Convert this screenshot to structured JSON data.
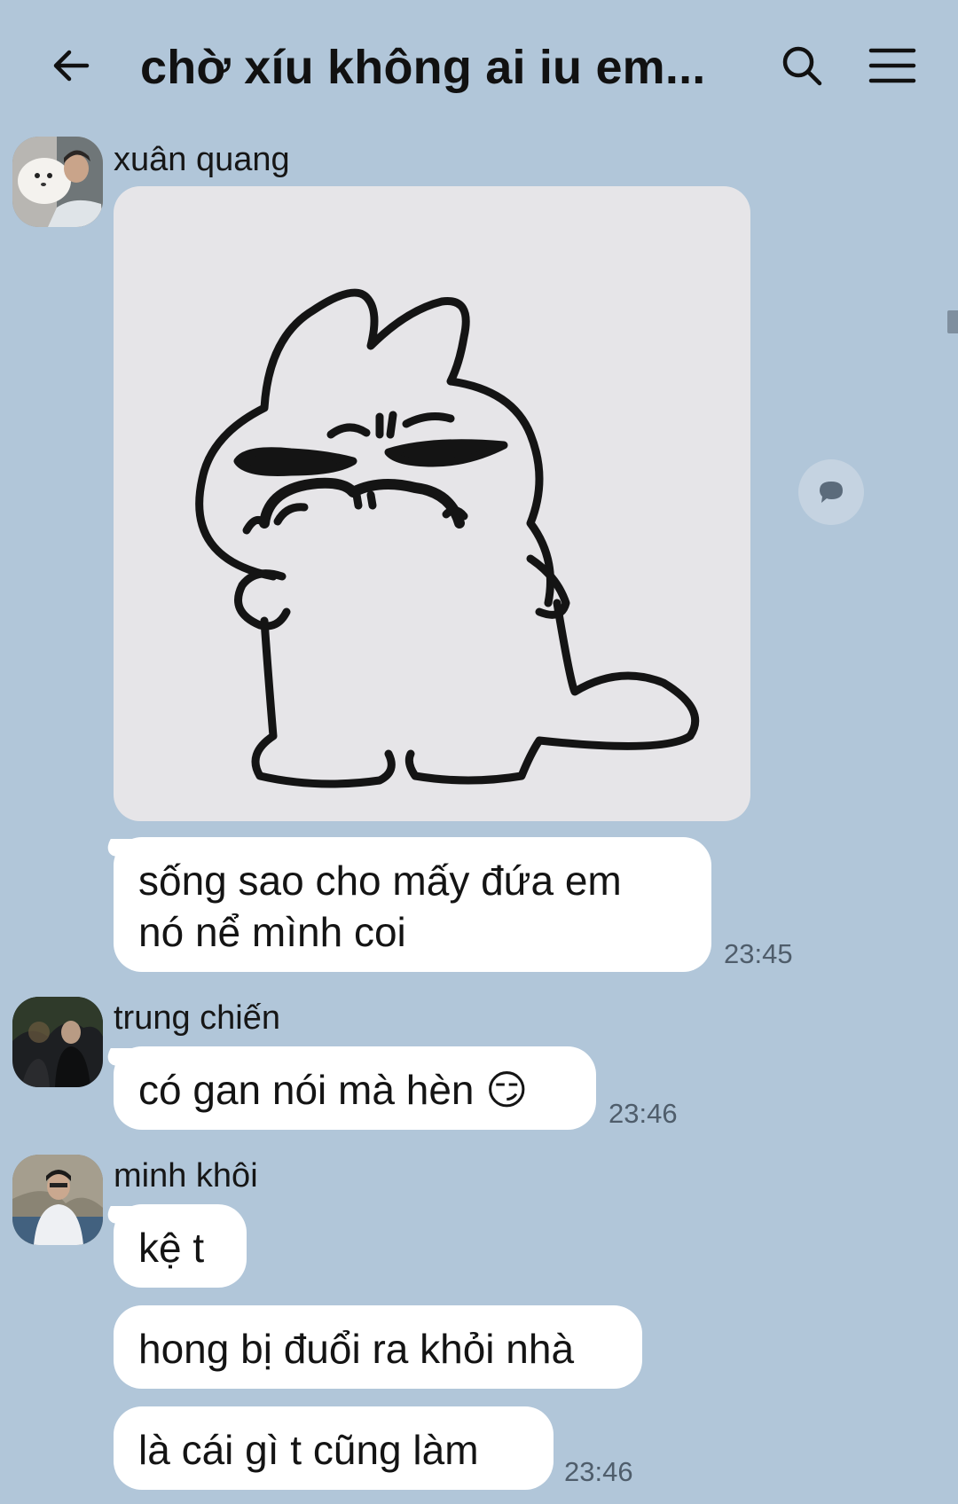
{
  "header": {
    "title": "chờ xíu không ai iu em...",
    "back_icon": "arrow-left-icon",
    "search_icon": "search-icon",
    "menu_icon": "hamburger-menu-icon"
  },
  "colors": {
    "background": "#b1c6d9",
    "bubble": "#ffffff",
    "timestamp": "#4f5d6b"
  },
  "messages": [
    {
      "sender": "xuân quang",
      "items": [
        {
          "kind": "sticker",
          "description_icon": "grumpy-blob-sticker"
        },
        {
          "kind": "text",
          "lines": [
            "sống sao cho mấy đứa em",
            "nó nể mình coi"
          ],
          "time": "23:45"
        }
      ]
    },
    {
      "sender": "trung chiến",
      "items": [
        {
          "kind": "text",
          "lines": [
            "có gan nói mà hèn 😏"
          ],
          "time": "23:46"
        }
      ]
    },
    {
      "sender": "minh khôi",
      "items": [
        {
          "kind": "text",
          "lines": [
            "kệ t"
          ]
        },
        {
          "kind": "text",
          "lines": [
            "hong bị đuổi ra khỏi nhà"
          ]
        },
        {
          "kind": "text",
          "lines": [
            "là cái gì t cũng làm"
          ],
          "time": "23:46"
        }
      ]
    }
  ]
}
